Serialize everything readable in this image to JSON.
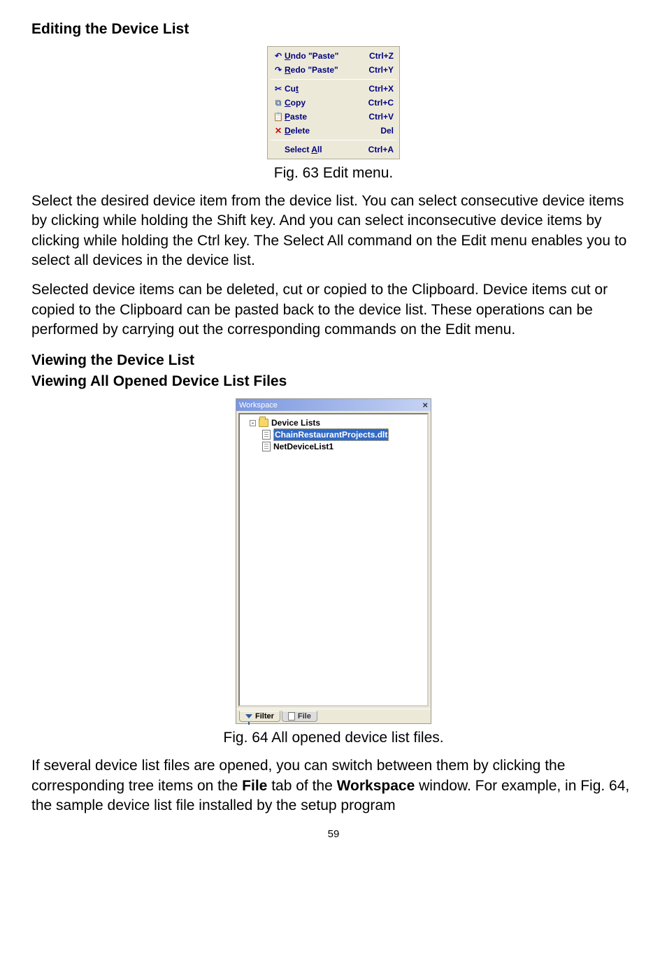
{
  "section1": {
    "title": "Editing the Device List"
  },
  "edit_menu": {
    "items_group1": [
      {
        "icon": "↶",
        "icon_class": "ic-undo",
        "label_pre": "",
        "ul": "U",
        "label_post": "ndo \"Paste\"",
        "shortcut": "Ctrl+Z"
      },
      {
        "icon": "↷",
        "icon_class": "ic-redo",
        "label_pre": "",
        "ul": "R",
        "label_post": "edo \"Paste\"",
        "shortcut": "Ctrl+Y"
      }
    ],
    "items_group2": [
      {
        "icon": "✂",
        "icon_class": "ic-cut",
        "label_pre": "Cu",
        "ul": "t",
        "label_post": "",
        "shortcut": "Ctrl+X"
      },
      {
        "icon": "⧉",
        "icon_class": "ic-copy",
        "label_pre": "",
        "ul": "C",
        "label_post": "opy",
        "shortcut": "Ctrl+C"
      },
      {
        "icon": "📋",
        "icon_class": "ic-paste",
        "label_pre": "",
        "ul": "P",
        "label_post": "aste",
        "shortcut": "Ctrl+V"
      },
      {
        "icon": "✕",
        "icon_class": "ic-del",
        "label_pre": "",
        "ul": "D",
        "label_post": "elete",
        "shortcut": "Del"
      }
    ],
    "items_group3": [
      {
        "icon": "",
        "icon_class": "",
        "label_pre": "Select ",
        "ul": "A",
        "label_post": "ll",
        "shortcut": "Ctrl+A"
      }
    ]
  },
  "fig63_caption": "Fig. 63 Edit menu.",
  "para1": "Select the desired device item from the device list. You can select consecutive device items by clicking while holding the Shift key. And you can select inconsecutive device items by clicking while holding the Ctrl key. The Select All command on the Edit menu enables you to select all devices in the device list.",
  "para2": "Selected device items can be deleted, cut or copied to the Clipboard. Device items cut or copied to the Clipboard can be pasted back to the device list. These operations can be performed by carrying out the corresponding commands on the Edit menu.",
  "section2": {
    "title": "Viewing the Device List",
    "subtitle": "Viewing All Opened Device List Files"
  },
  "workspace": {
    "title": "Workspace",
    "root": "Device Lists",
    "items": [
      {
        "label": "ChainRestaurantProjects.dlt",
        "selected": true
      },
      {
        "label": "NetDeviceList1",
        "selected": false
      }
    ],
    "tabs": {
      "filter": "Filter",
      "file": "File"
    }
  },
  "fig64_caption": "Fig. 64 All opened device list files.",
  "para3_pre": "If several device list files are opened, you can switch between them by clicking the corresponding tree items on the ",
  "para3_b1": "File",
  "para3_mid": " tab of the ",
  "para3_b2": "Workspace",
  "para3_post": " window. For example, in Fig. 64, the sample device list file installed by the setup program",
  "pagenum": "59"
}
